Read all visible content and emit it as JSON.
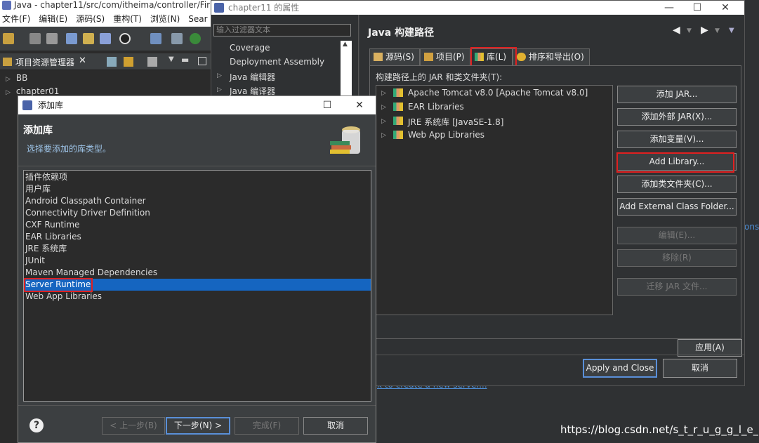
{
  "eclipse": {
    "title": "Java - chapter11/src/com/itheima/controller/Fir",
    "menu": [
      "文件(F)",
      "编辑(E)",
      "源码(S)",
      "重构(T)",
      "浏览(N)",
      "Sear"
    ],
    "project_view_title": "项目资源管理器",
    "project_items": [
      "BB",
      "chapter01"
    ],
    "link_fragment": "k to create a new server...",
    "right_fragment": "ons",
    "watermark": "https://blog.csdn.net/s_t_r_u_g_g_l_e_"
  },
  "properties": {
    "title": "chapter11 的属性",
    "filter_placeholder": "输入过滤器文本",
    "nav_items": [
      "Coverage",
      "Deployment Assembly",
      "Java 编辑器",
      "Java 编译器"
    ],
    "page_title": "Java 构建路径",
    "tabs": [
      "源码(S)",
      "项目(P)",
      "库(L)",
      "排序和导出(O)"
    ],
    "jar_label": "构建路径上的 JAR 和类文件夹(T):",
    "libraries": [
      "Apache Tomcat v8.0 [Apache Tomcat v8.0]",
      "EAR Libraries",
      "JRE 系统库 [JavaSE-1.8]",
      "Web App Libraries"
    ],
    "buttons": {
      "add_jar": "添加 JAR...",
      "add_external_jar": "添加外部 JAR(X)...",
      "add_variable": "添加变量(V)...",
      "add_library": "Add Library...",
      "add_class_folder": "添加类文件夹(C)...",
      "add_external_class_folder": "Add External Class Folder...",
      "edit": "编辑(E)...",
      "remove": "移除(R)",
      "migrate_jar": "迁移 JAR 文件..."
    },
    "apply": "应用(A)",
    "apply_and_close": "Apply and Close",
    "cancel": "取消"
  },
  "add_library": {
    "title": "添加库",
    "heading": "添加库",
    "description": "选择要添加的库类型。",
    "items": [
      "插件依赖项",
      "用户库",
      "Android Classpath Container",
      "Connectivity Driver Definition",
      "CXF Runtime",
      "EAR Libraries",
      "JRE 系统库",
      "JUnit",
      "Maven Managed Dependencies",
      "Server Runtime",
      "Web App Libraries"
    ],
    "selected_index": 9,
    "buttons": {
      "back": "< 上一步(B)",
      "next": "下一步(N) >",
      "finish": "完成(F)",
      "cancel": "取消"
    }
  },
  "colors": {
    "selection": "#1565c0",
    "highlight_box": "#e02020",
    "default_button_border": "#5a8fd8"
  }
}
